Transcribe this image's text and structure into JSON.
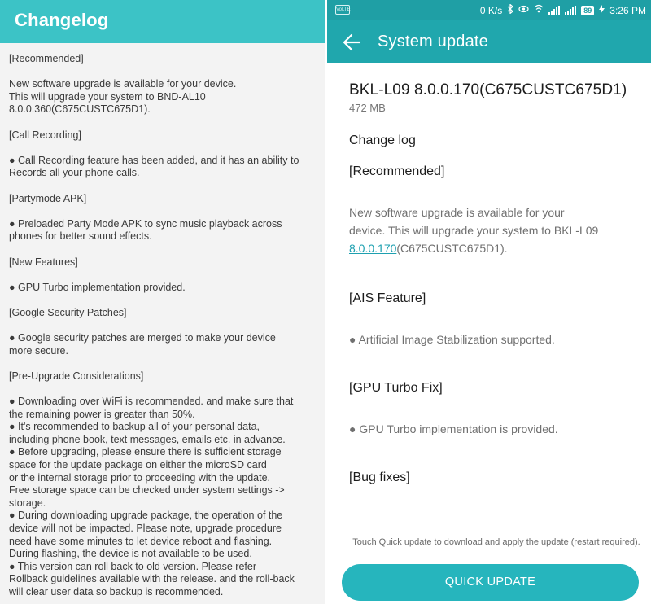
{
  "left": {
    "title": "Changelog",
    "blocks": [
      [
        "[Recommended]"
      ],
      [
        "New software upgrade is available for your device.",
        "This will upgrade your system to BND-AL10",
        "8.0.0.360(C675CUSTC675D1)."
      ],
      [
        "[Call Recording]"
      ],
      [
        "● Call Recording feature has been added, and it has an ability to",
        "Records all your phone calls."
      ],
      [
        "[Partymode APK]"
      ],
      [
        "● Preloaded Party Mode APK to sync music playback across",
        "phones for better sound effects."
      ],
      [
        "[New Features]"
      ],
      [
        "● GPU Turbo implementation provided."
      ],
      [
        "[Google Security Patches]"
      ],
      [
        "● Google security patches are merged to make your device",
        "more secure."
      ],
      [
        "[Pre-Upgrade Considerations]"
      ],
      [
        "● Downloading over WiFi is recommended. and make sure that",
        "the remaining power is greater than 50%.",
        "● It's recommended to backup all of your personal data,",
        "including phone book, text messages, emails etc. in advance.",
        "● Before upgrading, please ensure there is sufficient storage",
        "space for the update package on either the microSD card",
        "or the internal storage prior to proceeding with the update.",
        "Free storage space can be checked under system settings ->",
        "storage.",
        "● During downloading upgrade package, the operation of the",
        "device will not be impacted. Please note, upgrade procedure",
        "need have some minutes to let device reboot and flashing.",
        "During flashing, the device is not available to be used.",
        "● This version can roll back to old version. Please refer",
        "Rollback guidelines available with the release. and the roll-back",
        "will clear user data so backup is recommended."
      ]
    ]
  },
  "statusbar": {
    "notification_badge": "VoLTE",
    "speed": "0 K/s",
    "battery": "89",
    "time": "3:26 PM",
    "icons": [
      "bluetooth-icon",
      "eye-comfort-icon",
      "wifi-calling-icon",
      "signal-icon",
      "signal-icon",
      "battery-icon",
      "charging-icon"
    ]
  },
  "right": {
    "appbar_title": "System update",
    "version": "BKL-L09 8.0.0.170(C675CUSTC675D1)",
    "size": "472 MB",
    "changelog_label": "Change log",
    "recommended_title": "[Recommended]",
    "recommended_text_1": "New software upgrade is available for your",
    "recommended_text_2": "device. This will upgrade your system to BKL-L09",
    "recommended_link": "8.0.0.170",
    "recommended_text_3": "(C675CUSTC675D1).",
    "ais_title": "[AIS Feature]",
    "ais_text": "● Artificial Image Stabilization supported.",
    "gpu_title": "[GPU Turbo Fix]",
    "gpu_text": "● GPU Turbo implementation is provided.",
    "bug_title": "[Bug fixes]",
    "footer_note": "Touch Quick update to download and apply the update (restart required).",
    "button_label": "QUICK UPDATE"
  },
  "colors": {
    "left_header": "#3cc3c6",
    "statusbar": "#1f9fa5",
    "appbar": "#20a7ad",
    "button": "#26b5bd",
    "link": "#1ea0b0"
  }
}
